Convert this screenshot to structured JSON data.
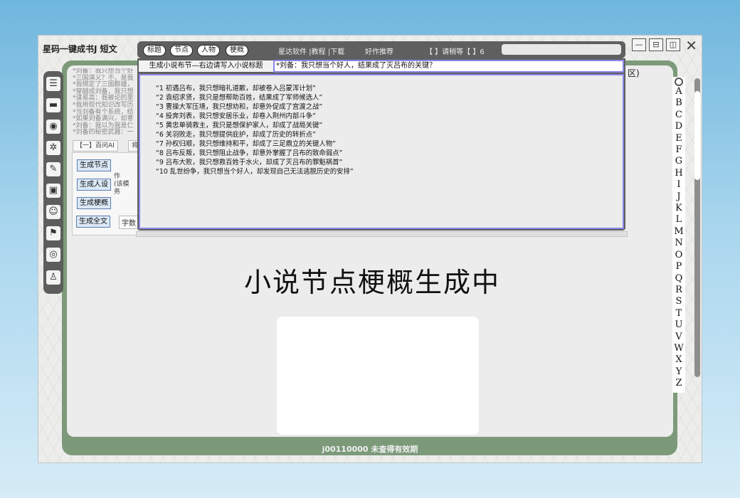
{
  "window": {
    "title": "星码一键成书J  短文",
    "controls": {
      "minimize": "—",
      "restore": "⊟",
      "maximize": "◫",
      "close": "✕"
    }
  },
  "toolbar": {
    "tabs": [
      "标题",
      "节点",
      "人物",
      "梗概"
    ],
    "links": "星达软件 |教程 |下载",
    "recommend": "好作推荐",
    "wait_text": "【 】请稍等【 】6",
    "search_value": ""
  },
  "dialog": {
    "prompt_label": "生成小说布节—右边请写入小说标题",
    "title_input": "*刘备：我只想当个好人，结果成了灭吕布的关键？",
    "outline": [
      "“1 初遇吕布，我只想暗礼道歉，却被卷入吕蒙浑计划”",
      "“2 袁绍求贤，我只是想帮助百姓，结果成了军师候选人”",
      "“3 曹操大军压境，我只想劝和，却意外促成了宫渡之战”",
      "“4 投奔刘表，我只想安居乐业，却卷入荆州内部斗争”",
      "“5 黄忠单骑救主，我只是想保护家人，却成了战局关键”",
      "“6 关羽败走，我只想提供庇护，却成了历史的转折点”",
      "“7 孙权归顺，我只想维持和平，却成了三足鼎立的关键人物”",
      "“8 吕布反叛，我只想阻止战争，却意外掌握了吕布的致命弱点”",
      "“9 吕布大败，我只想救百姓于水火，却成了灭吕布的罪魁祸首”",
      "“10 乱世纷争，我只想当个好人，却发现自己无法逃脱历史的安排”"
    ]
  },
  "background_panel": {
    "notes": [
      "*刘备：我只想当个好",
      "*三国演义？不，是我",
      "*我绑定了三国群雄，",
      "*穿越成刘备，我只想",
      "*谋易高：我被论的里",
      "*我用现代知识改写历",
      "*当刘备有个系统，结",
      "*如果刘备满兴，却意",
      "*刘备：我以为我是仁",
      "*刘备的秘密武器：一"
    ],
    "tab_left": "【一】百问AI",
    "tab_right": "将",
    "buttons": [
      "生成节点",
      "生成人设",
      "生成梗概",
      "生成全文"
    ],
    "side_text": [
      "作",
      "(该模",
      "务"
    ],
    "word_count_label": "字数"
  },
  "main": {
    "loading_title": "小说节点梗概生成中"
  },
  "right_panel": {
    "qu": "区)",
    "letters": [
      "A",
      "B",
      "C",
      "D",
      "E",
      "F",
      "G",
      "H",
      "I",
      "J",
      "K",
      "L",
      "M",
      "N",
      "O",
      "P",
      "Q",
      "R",
      "S",
      "T",
      "U",
      "V",
      "W",
      "X",
      "Y",
      "Z"
    ]
  },
  "status": {
    "text": "j00110000   未查得有效期"
  },
  "icons": [
    "document-list-icon",
    "book-icon",
    "disc-icon",
    "compass-icon",
    "edit-note-icon",
    "monitor-icon",
    "user-icon",
    "stamp-icon",
    "disc-alt-icon",
    "person-icon",
    "settings-icon"
  ]
}
